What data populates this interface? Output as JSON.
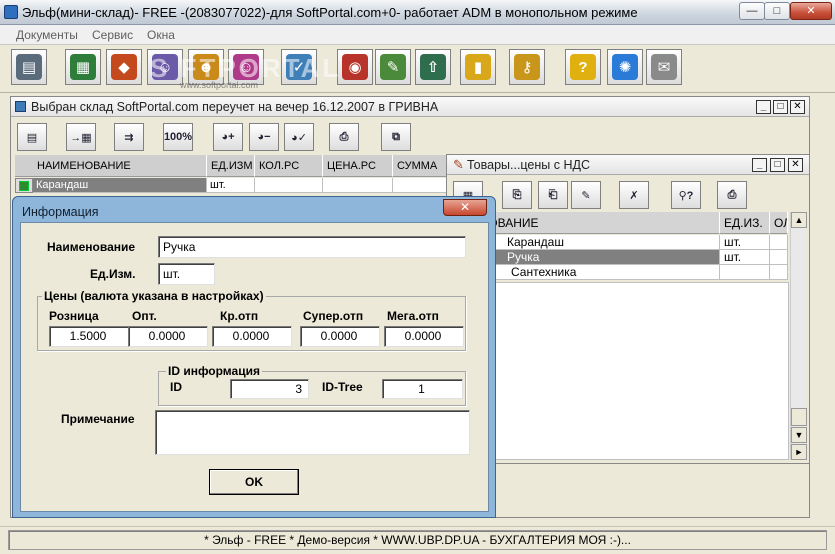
{
  "main_window": {
    "title": "Эльф(мини-склад)- FREE -(2083077022)-для SoftPortal.com+0- работает ADM в монопольном режиме",
    "controls": {
      "minimize": "—",
      "maximize": "□",
      "close": "✕"
    }
  },
  "menu": {
    "items": [
      "Документы",
      "Сервис",
      "Окна"
    ]
  },
  "toolbar": {
    "buttons": [
      {
        "name": "documents-icon",
        "glyph": "▤",
        "color": "#5a6b7c"
      },
      {
        "name": "catalog-icon",
        "glyph": "▦",
        "color": "#2f7d3a"
      },
      {
        "name": "goods-icon",
        "glyph": "◆",
        "color": "#c44a1e"
      },
      {
        "name": "people-icon",
        "glyph": "☺",
        "color": "#6a5aa8"
      },
      {
        "name": "partners-icon",
        "glyph": "☻",
        "color": "#c98a1a"
      },
      {
        "name": "users-icon",
        "glyph": "☺",
        "color": "#b03a8a"
      },
      {
        "name": "chart-icon",
        "glyph": "✓",
        "color": "#3f7fb8"
      },
      {
        "name": "inventory-icon",
        "glyph": "◉",
        "color": "#b8342a"
      },
      {
        "name": "edit-icon",
        "glyph": "✎",
        "color": "#4a8a3a"
      },
      {
        "name": "exit-icon",
        "glyph": "⇧",
        "color": "#2e6e4e"
      },
      {
        "name": "reports-icon",
        "glyph": "▮",
        "color": "#d8a81a"
      },
      {
        "name": "key-icon",
        "glyph": "⚷",
        "color": "#c8961a"
      },
      {
        "name": "help-icon",
        "glyph": "?",
        "color": "#e0b010"
      },
      {
        "name": "update-icon",
        "glyph": "✺",
        "color": "#2a7ad8"
      },
      {
        "name": "mail-icon",
        "glyph": "✉",
        "color": "#8a8a8a"
      }
    ],
    "watermark": "S  FTPORTAL",
    "watermark_url": "www.softportal.com"
  },
  "stock_window": {
    "title": "Выбран склад SoftPortal.com переучет на вечер 16.12.2007 в ГРИВНА",
    "toolbar": [
      "▤",
      "→▦",
      "⇉",
      "100%",
      "◕+",
      "◕−",
      "◕✓",
      "⎙",
      "⧉"
    ],
    "columns": [
      "НАИМЕНОВАНИЕ",
      "ЕД.ИЗМ",
      "КОЛ.РС",
      "ЦЕНА.РС",
      "СУММА"
    ],
    "rows": [
      {
        "name": "Карандаш",
        "unit": "шт.",
        "qty": "",
        "price": "",
        "sum": ""
      }
    ]
  },
  "goods_window": {
    "title": "Товары...цены с НДС",
    "toolbar": [
      "▦",
      "⎘",
      "⎗",
      "✎",
      "✗",
      "⚲?",
      "⎙"
    ],
    "columns": [
      "ИМЕНОВАНИЕ",
      "ЕД.ИЗ.",
      "ОЛ."
    ],
    "rows": [
      {
        "name": "Карандаш",
        "unit": "шт.",
        "selected": false
      },
      {
        "name": "Ручка",
        "unit": "шт.",
        "selected": true
      },
      {
        "name": "Сантехника",
        "unit": "",
        "selected": false
      }
    ]
  },
  "dialog": {
    "title": "Информация",
    "close": "✕",
    "name_label": "Наименование",
    "name_value": "Ручка",
    "unit_label": "Ед.Изм.",
    "unit_value": "шт.",
    "prices_group": "Цены (валюта указана в настройках)",
    "price_labels": [
      "Розница",
      "Опт.",
      "Кр.отп",
      "Супер.отп",
      "Мега.отп"
    ],
    "price_values": [
      "1.5000",
      "0.0000",
      "0.0000",
      "0.0000",
      "0.0000"
    ],
    "id_group": "ID информация",
    "id_label": "ID",
    "id_value": "3",
    "idtree_label": "ID-Tree",
    "idtree_value": "1",
    "note_label": "Примечание",
    "note_value": "",
    "ok_label": "OK"
  },
  "status": {
    "text": "* Эльф - FREE * Демо-версия * WWW.UBP.DP.UA - БУХГАЛТЕРИЯ МОЯ :-)..."
  }
}
